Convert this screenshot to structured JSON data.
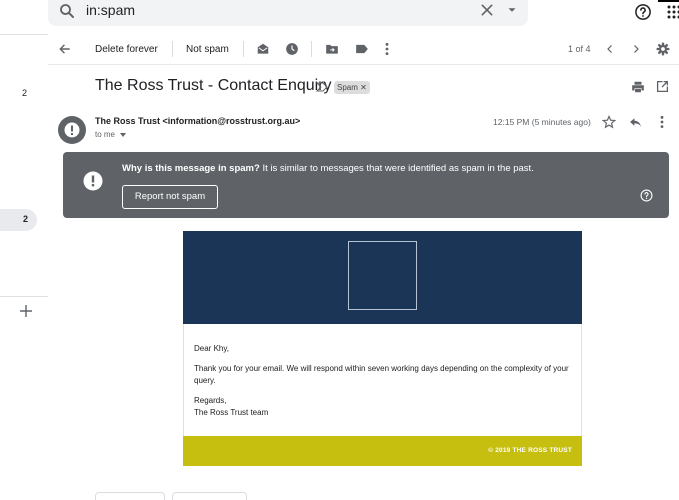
{
  "search": {
    "query": "in:spam"
  },
  "sidebar": {
    "counts": [
      "2",
      "2"
    ]
  },
  "toolbar": {
    "delete_forever_label": "Delete forever",
    "not_spam_label": "Not spam",
    "pagination": "1 of 4"
  },
  "message": {
    "subject": "The Ross Trust - Contact Enquiry",
    "label_chip": "Spam",
    "sender": "The Ross Trust <information@rosstrust.org.au>",
    "recipient": "to me",
    "timestamp": "12:15 PM (5 minutes ago)"
  },
  "spam_banner": {
    "question": "Why is this message in spam?",
    "explanation": "It is similar to messages that were identified as spam in the past.",
    "report_button": "Report not spam"
  },
  "email_body": {
    "greeting": "Dear Khy,",
    "paragraph": "Thank you for your email. We will respond within seven working days depending on the complexity of your query.",
    "signoff": "Regards,",
    "signature": "The Ross Trust team",
    "footer": "© 2019 THE ROSS TRUST",
    "colors": {
      "header_bg": "#1b3556",
      "footer_bg": "#c7bf10"
    }
  }
}
